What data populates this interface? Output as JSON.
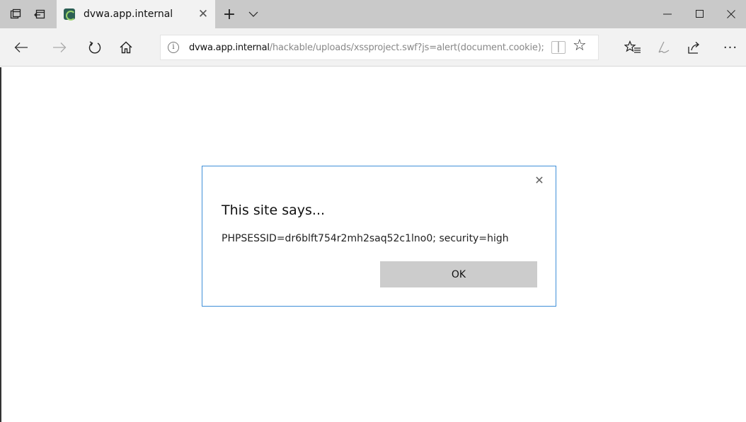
{
  "tab": {
    "title": "dvwa.app.internal"
  },
  "address_bar": {
    "url_host": "dvwa.app.internal",
    "url_path": "/hackable/uploads/xssproject.swf?js=alert(document.cookie);"
  },
  "dialog": {
    "title": "This site says...",
    "message": "PHPSESSID=dr6blft754r2mh2saq52c1lno0; security=high",
    "ok_label": "OK"
  },
  "colors": {
    "titlebar": "#c9c9c9",
    "navbar": "#f2f2f2",
    "dialog_border": "#3f8fd8",
    "ok_button": "#cccccc"
  },
  "icons": [
    "tab-aside-icon",
    "tab-back-icon",
    "favicon-icon",
    "close-icon",
    "plus-icon",
    "chevron-down-icon",
    "minimize-icon",
    "maximize-icon",
    "back-arrow-icon",
    "forward-arrow-icon",
    "refresh-icon",
    "home-icon",
    "info-icon",
    "reading-view-icon",
    "star-icon",
    "favorites-icon",
    "pen-icon",
    "share-icon",
    "more-icon"
  ]
}
